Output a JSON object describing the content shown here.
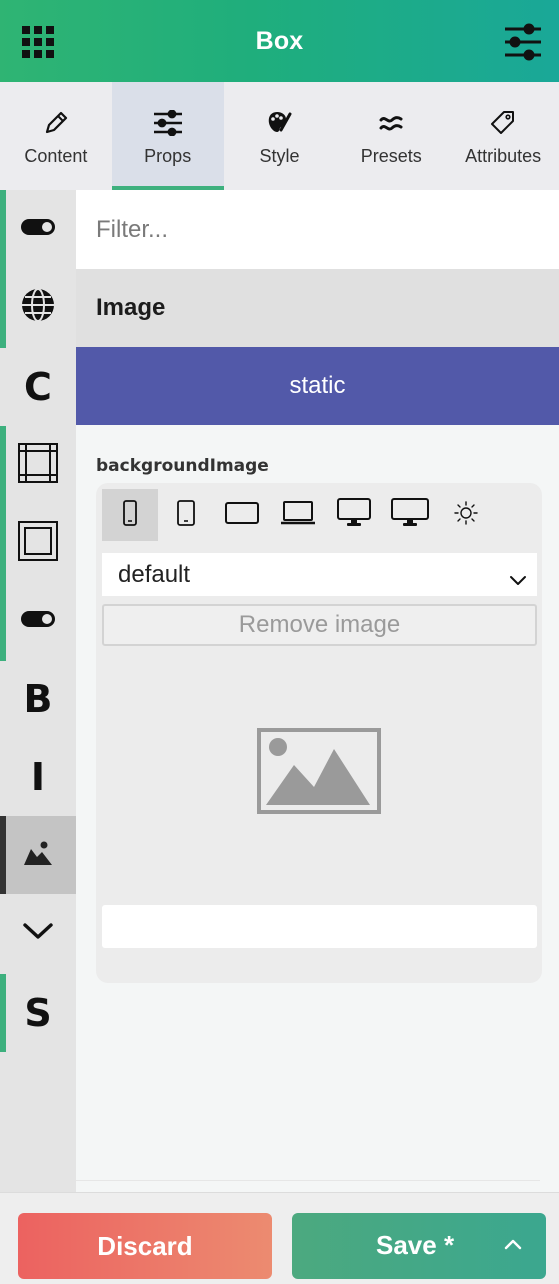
{
  "header": {
    "title": "Box"
  },
  "tabs": [
    {
      "label": "Content",
      "icon": "pencil-icon",
      "active": false
    },
    {
      "label": "Props",
      "icon": "sliders-icon",
      "active": true
    },
    {
      "label": "Style",
      "icon": "palette-icon",
      "active": false
    },
    {
      "label": "Presets",
      "icon": "waves-icon",
      "active": false
    },
    {
      "label": "Attributes",
      "icon": "tag-icon",
      "active": false
    }
  ],
  "sidebar": {
    "items": [
      {
        "icon": "toggle-icon"
      },
      {
        "icon": "globe-icon"
      },
      {
        "icon": "letter-c-icon",
        "letter": "C"
      },
      {
        "icon": "border-frame-icon"
      },
      {
        "icon": "padding-frame-icon"
      },
      {
        "icon": "toggle-icon"
      },
      {
        "icon": "bold-icon",
        "letter": "B"
      },
      {
        "icon": "italic-icon",
        "letter": "I"
      },
      {
        "icon": "image-icon",
        "active": true
      },
      {
        "icon": "chevron-down-icon"
      },
      {
        "icon": "letter-s-icon",
        "letter": "S"
      }
    ]
  },
  "filter": {
    "placeholder": "Filter..."
  },
  "section": {
    "title": "Image"
  },
  "position": {
    "value": "static"
  },
  "property": {
    "label": "backgroundImage",
    "devices": [
      "mobile-icon",
      "tablet-portrait-icon",
      "tablet-landscape-icon",
      "laptop-icon",
      "desktop-icon",
      "large-desktop-icon",
      "sun-icon"
    ],
    "select_value": "default",
    "remove_label": "Remove image",
    "url_value": ""
  },
  "footer": {
    "discard_label": "Discard",
    "save_label": "Save *"
  },
  "colors": {
    "accent": "#3db07e",
    "static_bg": "#5259a9",
    "discard": "#ec6260",
    "save": "#4ca97f"
  }
}
